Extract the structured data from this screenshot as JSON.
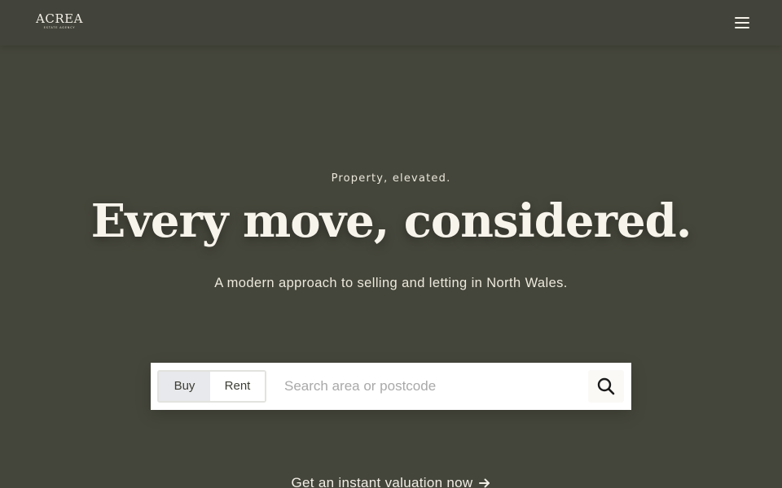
{
  "header": {
    "logo_text": "ACREA",
    "logo_subtext": "ESTATE AGENCY",
    "menu_icon": "hamburger-menu-icon"
  },
  "hero": {
    "eyebrow": "Property, elevated.",
    "headline": "Every move, considered.",
    "subheadline": "A modern approach to selling and letting in North Wales."
  },
  "search": {
    "tabs": [
      {
        "label": "Buy",
        "selected": true
      },
      {
        "label": "Rent",
        "selected": false
      }
    ],
    "placeholder": "Search area or postcode",
    "value": "",
    "button_icon": "search-icon"
  },
  "cta": {
    "valuation_label": "Get an instant valuation now",
    "valuation_icon": "arrow-right-icon"
  },
  "colors": {
    "background": "#45463b",
    "text": "#f4f1e8",
    "search_box": "#ffffff",
    "selected_tab": "#e8e9ec"
  }
}
